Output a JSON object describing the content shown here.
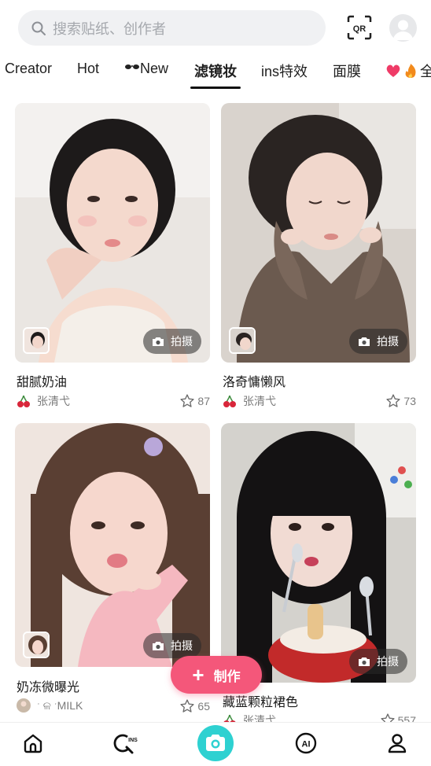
{
  "search": {
    "placeholder": "搜索贴纸、创作者",
    "icon": "search-icon"
  },
  "header": {
    "qr_label": "QR",
    "avatar_icon": "user-avatar"
  },
  "tabs": [
    {
      "label": "Creator"
    },
    {
      "label": "Hot"
    },
    {
      "label": "New",
      "prefix_icon": "sunglasses-icon"
    },
    {
      "label": "滤镜妆",
      "active": true
    },
    {
      "label": "ins特效"
    },
    {
      "label": "面膜"
    },
    {
      "label": "全",
      "prefix_icon": "heart-fire-icon"
    }
  ],
  "cards": [
    {
      "title": "甜腻奶油",
      "author": "张清弋",
      "likes": "87",
      "shoot": "拍摄"
    },
    {
      "title": "洛奇慵懒风",
      "author": "张清弋",
      "likes": "73",
      "shoot": "拍摄"
    },
    {
      "title": "奶冻微曝光",
      "author": "ˑ ଳ ˑMILK",
      "likes": "65",
      "shoot": "拍摄"
    },
    {
      "title": "藏蓝颗粒裙色",
      "author": "张清弋",
      "likes": "557",
      "shoot": "拍摄"
    }
  ],
  "fab": {
    "label": "制作"
  },
  "bottom_nav": [
    "home-icon",
    "ins-search-icon",
    "camera-icon",
    "ai-icon",
    "profile-icon"
  ],
  "colors": {
    "accent_pink": "#f4577a",
    "accent_teal": "#2ed1d1"
  }
}
